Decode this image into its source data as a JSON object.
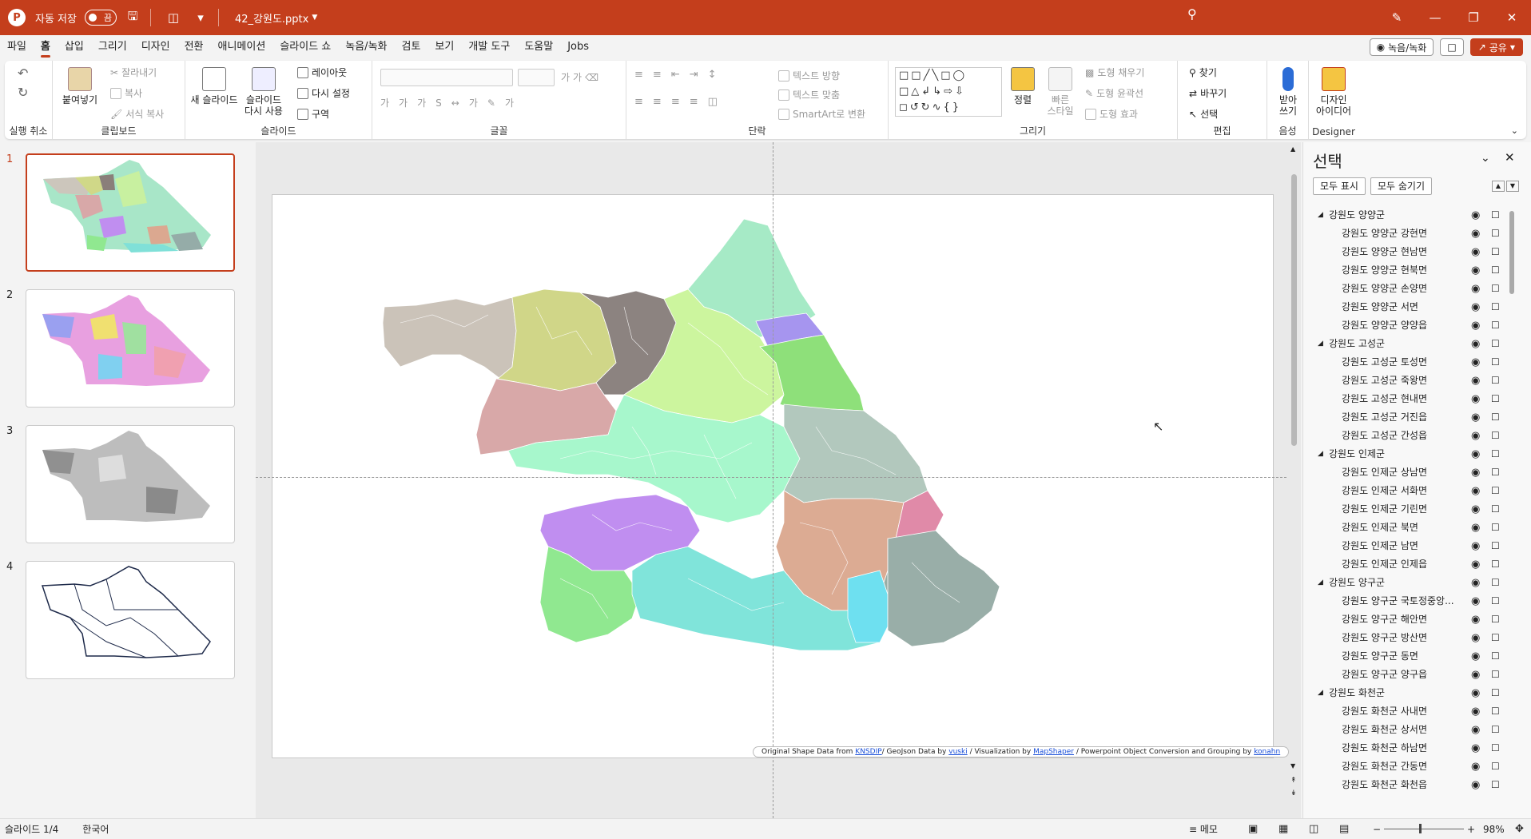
{
  "titlebar": {
    "autosave_label": "자동 저장",
    "autosave_state": "끔",
    "filename": "42_강원도.pptx",
    "icons": [
      "save-icon",
      "print-preview-icon",
      "customize-qat-icon",
      "search-icon",
      "pen-icon",
      "minimize-icon",
      "restore-icon",
      "close-icon"
    ]
  },
  "menu": {
    "items": [
      "파일",
      "홈",
      "삽입",
      "그리기",
      "디자인",
      "전환",
      "애니메이션",
      "슬라이드 쇼",
      "녹음/녹화",
      "검토",
      "보기",
      "개발 도구",
      "도움말",
      "Jobs"
    ],
    "active": "홈",
    "record_label": "녹음/녹화",
    "share_label": "공유"
  },
  "ribbon": {
    "groups": {
      "undo": "실행 취소",
      "clipboard": "클립보드",
      "slides": "슬라이드",
      "font": "글꼴",
      "paragraph": "단락",
      "drawing": "그리기",
      "editing": "편집",
      "voice": "음성",
      "designer": "Designer"
    },
    "buttons": {
      "paste": "붙여넣기",
      "cut": "잘라내기",
      "copy": "복사",
      "format_painter": "서식 복사",
      "new_slide": "새 슬라이드",
      "reuse_slide_1": "슬라이드",
      "reuse_slide_2": "다시 사용",
      "layout": "레이아웃",
      "reset": "다시 설정",
      "section": "구역",
      "text_direction": "텍스트 방향",
      "align_text": "텍스트 맞춤",
      "smartart": "SmartArt로 변환",
      "arrange": "정렬",
      "quick_styles_1": "빠른",
      "quick_styles_2": "스타일",
      "shape_fill": "도형 채우기",
      "shape_outline": "도형 윤곽선",
      "shape_effects": "도형 효과",
      "find": "찾기",
      "replace": "바꾸기",
      "select": "선택",
      "dictate_1": "받아",
      "dictate_2": "쓰기",
      "designer_1": "디자인",
      "designer_2": "아이디어"
    }
  },
  "slides": {
    "numbers": [
      "1",
      "2",
      "3",
      "4"
    ],
    "selected": 1
  },
  "slide": {
    "credit_parts": {
      "p1": "Original Shape Data from",
      "l1": "KNSDIP",
      "p2": "/ GeoJson Data by",
      "l2": "vuski",
      "p3": "/ Visualization  by",
      "l3": "MapShaper",
      "p4": "/ Powerpoint Object Conversion and Grouping  by",
      "l4": "konahn"
    }
  },
  "selection_pane": {
    "title": "선택",
    "show_all": "모두 표시",
    "hide_all": "모두 숨기기",
    "rows": [
      {
        "label": "강원도 양양군",
        "level": 0
      },
      {
        "label": "강원도 양양군 강현면",
        "level": 1
      },
      {
        "label": "강원도 양양군 현남면",
        "level": 1
      },
      {
        "label": "강원도 양양군 현북면",
        "level": 1
      },
      {
        "label": "강원도 양양군 손양면",
        "level": 1
      },
      {
        "label": "강원도 양양군 서면",
        "level": 1
      },
      {
        "label": "강원도 양양군 양양읍",
        "level": 1
      },
      {
        "label": "강원도 고성군",
        "level": 0
      },
      {
        "label": "강원도 고성군 토성면",
        "level": 1
      },
      {
        "label": "강원도 고성군 죽왕면",
        "level": 1
      },
      {
        "label": "강원도 고성군 현내면",
        "level": 1
      },
      {
        "label": "강원도 고성군 거진읍",
        "level": 1
      },
      {
        "label": "강원도 고성군 간성읍",
        "level": 1
      },
      {
        "label": "강원도 인제군",
        "level": 0
      },
      {
        "label": "강원도 인제군 상남면",
        "level": 1
      },
      {
        "label": "강원도 인제군 서화면",
        "level": 1
      },
      {
        "label": "강원도 인제군 기린면",
        "level": 1
      },
      {
        "label": "강원도 인제군 북면",
        "level": 1
      },
      {
        "label": "강원도 인제군 남면",
        "level": 1
      },
      {
        "label": "강원도 인제군 인제읍",
        "level": 1
      },
      {
        "label": "강원도 양구군",
        "level": 0
      },
      {
        "label": "강원도 양구군 국토정중앙...",
        "level": 1
      },
      {
        "label": "강원도 양구군 해안면",
        "level": 1
      },
      {
        "label": "강원도 양구군 방산면",
        "level": 1
      },
      {
        "label": "강원도 양구군 동면",
        "level": 1
      },
      {
        "label": "강원도 양구군 양구읍",
        "level": 1
      },
      {
        "label": "강원도 화천군",
        "level": 0
      },
      {
        "label": "강원도 화천군 사내면",
        "level": 1
      },
      {
        "label": "강원도 화천군 상서면",
        "level": 1
      },
      {
        "label": "강원도 화천군 하남면",
        "level": 1
      },
      {
        "label": "강원도 화천군 간동면",
        "level": 1
      },
      {
        "label": "강원도 화천군 화천읍",
        "level": 1
      }
    ]
  },
  "statusbar": {
    "slide_info": "슬라이드 1/4",
    "language": "한국어",
    "notes": "메모",
    "zoom": "98%"
  },
  "colors": {
    "accent": "#c43e1c"
  }
}
